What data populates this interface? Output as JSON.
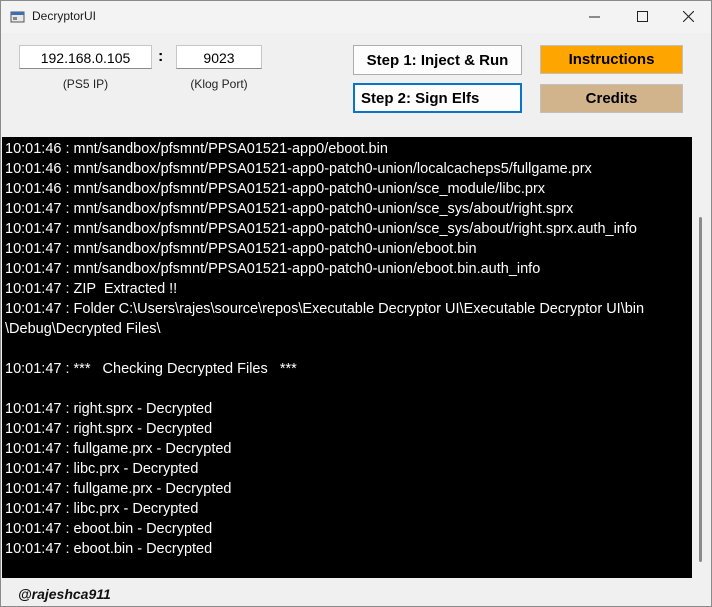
{
  "window": {
    "title": "DecryptorUI",
    "minimize": "—",
    "maximize": "☐",
    "close": "✕"
  },
  "connection": {
    "ip_value": "192.168.0.105",
    "ip_caption": "(PS5 IP)",
    "separator": ":",
    "port_value": "9023",
    "port_caption": "(Klog Port)"
  },
  "buttons": {
    "step1": "Step 1: Inject & Run",
    "step2": "Step 2: Sign Elfs",
    "instructions": "Instructions",
    "credits": "Credits"
  },
  "colors": {
    "instructions_bg": "#ffa500",
    "credits_bg": "#d2b48c",
    "log_bg": "#000000",
    "log_text": "#ffffff",
    "focus_border": "#0a74c9"
  },
  "log": [
    "10:01:46 : mnt/sandbox/pfsmnt/PPSA01521-app0/eboot.bin",
    "10:01:46 : mnt/sandbox/pfsmnt/PPSA01521-app0-patch0-union/localcacheps5/fullgame.prx",
    "10:01:46 : mnt/sandbox/pfsmnt/PPSA01521-app0-patch0-union/sce_module/libc.prx",
    "10:01:47 : mnt/sandbox/pfsmnt/PPSA01521-app0-patch0-union/sce_sys/about/right.sprx",
    "10:01:47 : mnt/sandbox/pfsmnt/PPSA01521-app0-patch0-union/sce_sys/about/right.sprx.auth_info",
    "10:01:47 : mnt/sandbox/pfsmnt/PPSA01521-app0-patch0-union/eboot.bin",
    "10:01:47 : mnt/sandbox/pfsmnt/PPSA01521-app0-patch0-union/eboot.bin.auth_info",
    "10:01:47 : ZIP  Extracted !!",
    "10:01:47 : Folder C:\\Users\\rajes\\source\\repos\\Executable Decryptor UI\\Executable Decryptor UI\\bin",
    "\\Debug\\Decrypted Files\\",
    "",
    "10:01:47 : ***   Checking Decrypted Files   ***",
    "",
    "10:01:47 : right.sprx - Decrypted",
    "10:01:47 : right.sprx - Decrypted",
    "10:01:47 : fullgame.prx - Decrypted",
    "10:01:47 : libc.prx - Decrypted",
    "10:01:47 : fullgame.prx - Decrypted",
    "10:01:47 : libc.prx - Decrypted",
    "10:01:47 : eboot.bin - Decrypted",
    "10:01:47 : eboot.bin - Decrypted"
  ],
  "footer": {
    "credit": "@rajeshca911"
  }
}
